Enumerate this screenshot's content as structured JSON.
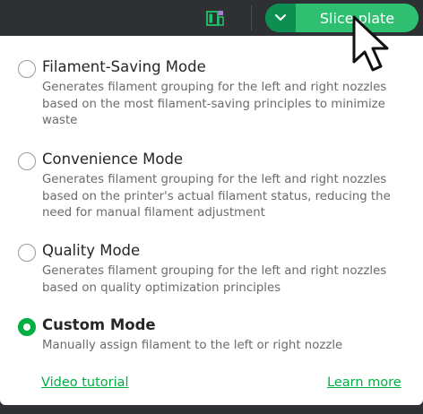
{
  "toolbar": {
    "layout_icon": "layout-grid-icon",
    "dropdown_icon": "chevron-down-icon",
    "slice_label": "Slice plate"
  },
  "modes": [
    {
      "title": "Filament-Saving Mode",
      "description": "Generates filament grouping for the left and right nozzles based on the most filament-saving principles to minimize waste",
      "selected": false
    },
    {
      "title": "Convenience Mode",
      "description": "Generates filament grouping for the left and right nozzles based on the printer's actual filament status, reducing the need for manual filament adjustment",
      "selected": false
    },
    {
      "title": "Quality Mode",
      "description": "Generates filament grouping for the left and right nozzles based on quality optimization principles",
      "selected": false
    },
    {
      "title": "Custom Mode",
      "description": "Manually assign filament to the left or right nozzle",
      "selected": true
    }
  ],
  "links": {
    "video_tutorial": "Video tutorial",
    "learn_more": "Learn more"
  },
  "colors": {
    "accent": "#00ae42",
    "slice_button": "#2fbf71",
    "toolbar_bg": "#2e3034"
  }
}
